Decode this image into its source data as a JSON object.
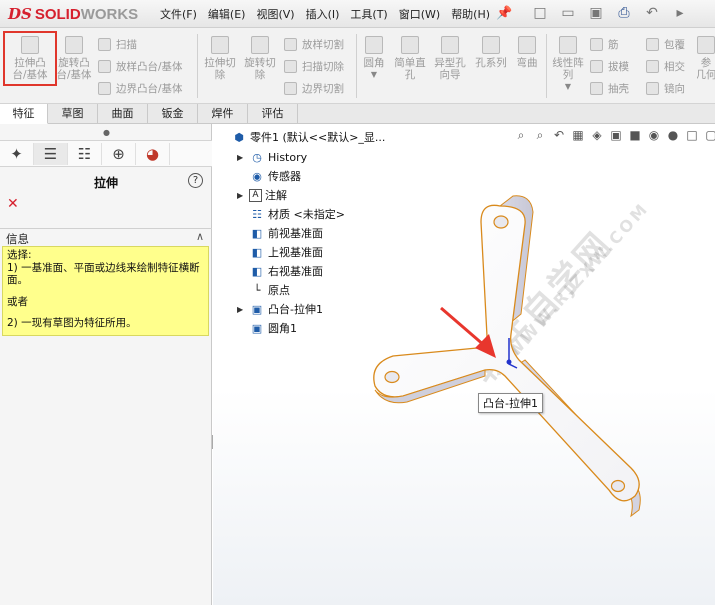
{
  "app": {
    "logo_ds": "DS",
    "logo_solid": "SOLID",
    "logo_works": "WORKS"
  },
  "menu": {
    "items": [
      "文件(F)",
      "编辑(E)",
      "视图(V)",
      "插入(I)",
      "工具(T)",
      "窗口(W)",
      "帮助(H)"
    ]
  },
  "commands": {
    "extrude_boss": "拉伸凸\n台/基体",
    "revolve_boss": "旋转凸\n台/基体",
    "sweep": "扫描",
    "loft_boss": "放样凸台/基体",
    "boundary_boss": "边界凸台/基体",
    "extrude_cut": "拉伸切\n除",
    "revolve_cut": "旋转切\n除",
    "loft_cut": "放样切割",
    "sweep_cut": "扫描切除",
    "boundary_cut": "边界切割",
    "fillet": "圆角",
    "simple_hole": "简单直\n孔",
    "hole_wizard": "异型孔\n向导",
    "hole_series": "孔系列",
    "flex": "弯曲",
    "linear_pattern": "线性阵\n列",
    "rib": "筋",
    "draft": "拔模",
    "shell": "抽壳",
    "wrap": "包覆",
    "intersect": "相交",
    "mirror": "镜向",
    "reference": "参\n几何"
  },
  "tabs": [
    "特征",
    "草图",
    "曲面",
    "钣金",
    "焊件",
    "评估"
  ],
  "active_tab": "特征",
  "property_manager": {
    "title": "拉伸",
    "info_label": "信息",
    "info_lines": [
      "选择:",
      "1) 一基准面、平面或边线来绘制特征横断面。",
      "或者",
      "2) 一现有草图为特征所用。"
    ]
  },
  "tree": {
    "root": "零件1  (默认<<默认>_显...",
    "items": [
      {
        "label": "History",
        "icon": "history-icon",
        "expandable": true
      },
      {
        "label": "传感器",
        "icon": "sensor-icon",
        "expandable": false
      },
      {
        "label": "注解",
        "icon": "annotation-icon",
        "expandable": true
      },
      {
        "label": "材质 <未指定>",
        "icon": "material-icon",
        "expandable": false
      },
      {
        "label": "前视基准面",
        "icon": "plane-icon",
        "expandable": false
      },
      {
        "label": "上视基准面",
        "icon": "plane-icon",
        "expandable": false
      },
      {
        "label": "右视基准面",
        "icon": "plane-icon",
        "expandable": false
      },
      {
        "label": "原点",
        "icon": "origin-icon",
        "expandable": false
      },
      {
        "label": "凸台-拉伸1",
        "icon": "boss-extrude-icon",
        "expandable": true
      },
      {
        "label": "圆角1",
        "icon": "fillet-icon",
        "expandable": false
      }
    ]
  },
  "tooltip": "凸台-拉伸1",
  "watermark": "软件自学网",
  "watermark_url": "WWW.RJZXW.COM",
  "colors": {
    "highlight": "#e0362c",
    "arrow": "#e8362d",
    "edge": "#d98a1c",
    "info_bg": "#ffff8c"
  }
}
